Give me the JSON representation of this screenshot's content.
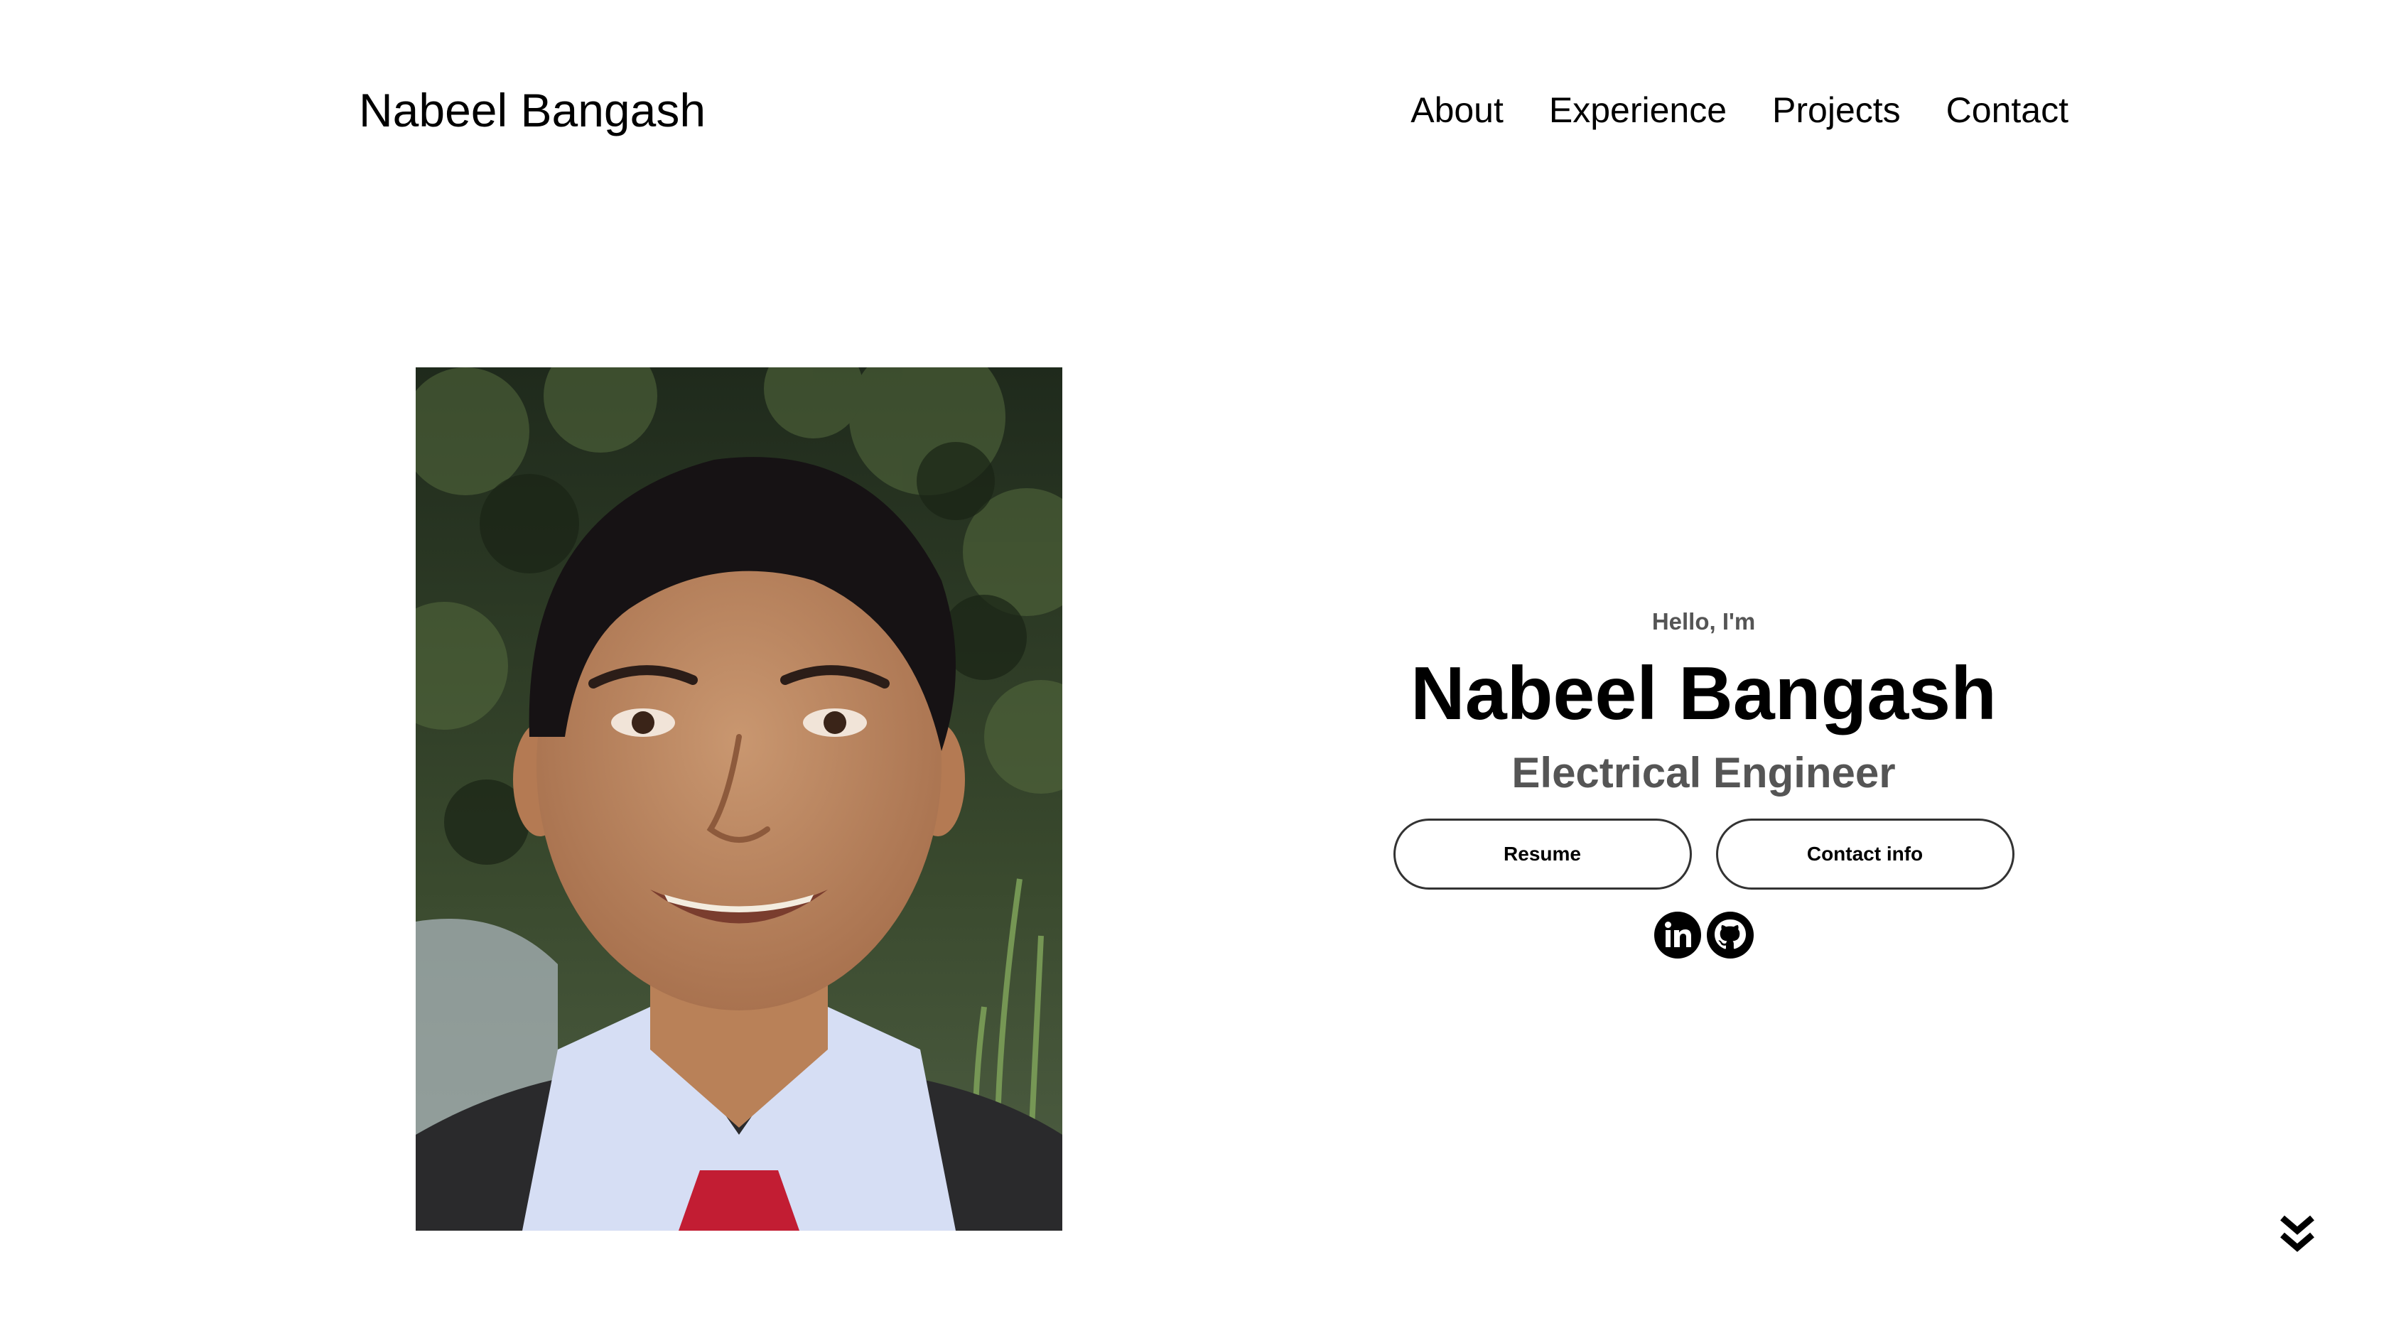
{
  "header": {
    "logo_text": "Nabeel Bangash",
    "nav": [
      {
        "label": "About"
      },
      {
        "label": "Experience"
      },
      {
        "label": "Projects"
      },
      {
        "label": "Contact"
      }
    ]
  },
  "hero": {
    "greeting": "Hello, I'm",
    "name": "Nabeel Bangash",
    "title": "Electrical Engineer",
    "buttons": {
      "resume": "Resume",
      "contact_info": "Contact info"
    },
    "socials": [
      {
        "icon": "linkedin-icon"
      },
      {
        "icon": "github-icon"
      }
    ]
  },
  "scroll_indicator": {
    "icon": "double-chevron-down-icon"
  },
  "colors": {
    "text": "#000000",
    "muted_text": "#555555",
    "button_border": "#333333",
    "background": "#ffffff"
  }
}
